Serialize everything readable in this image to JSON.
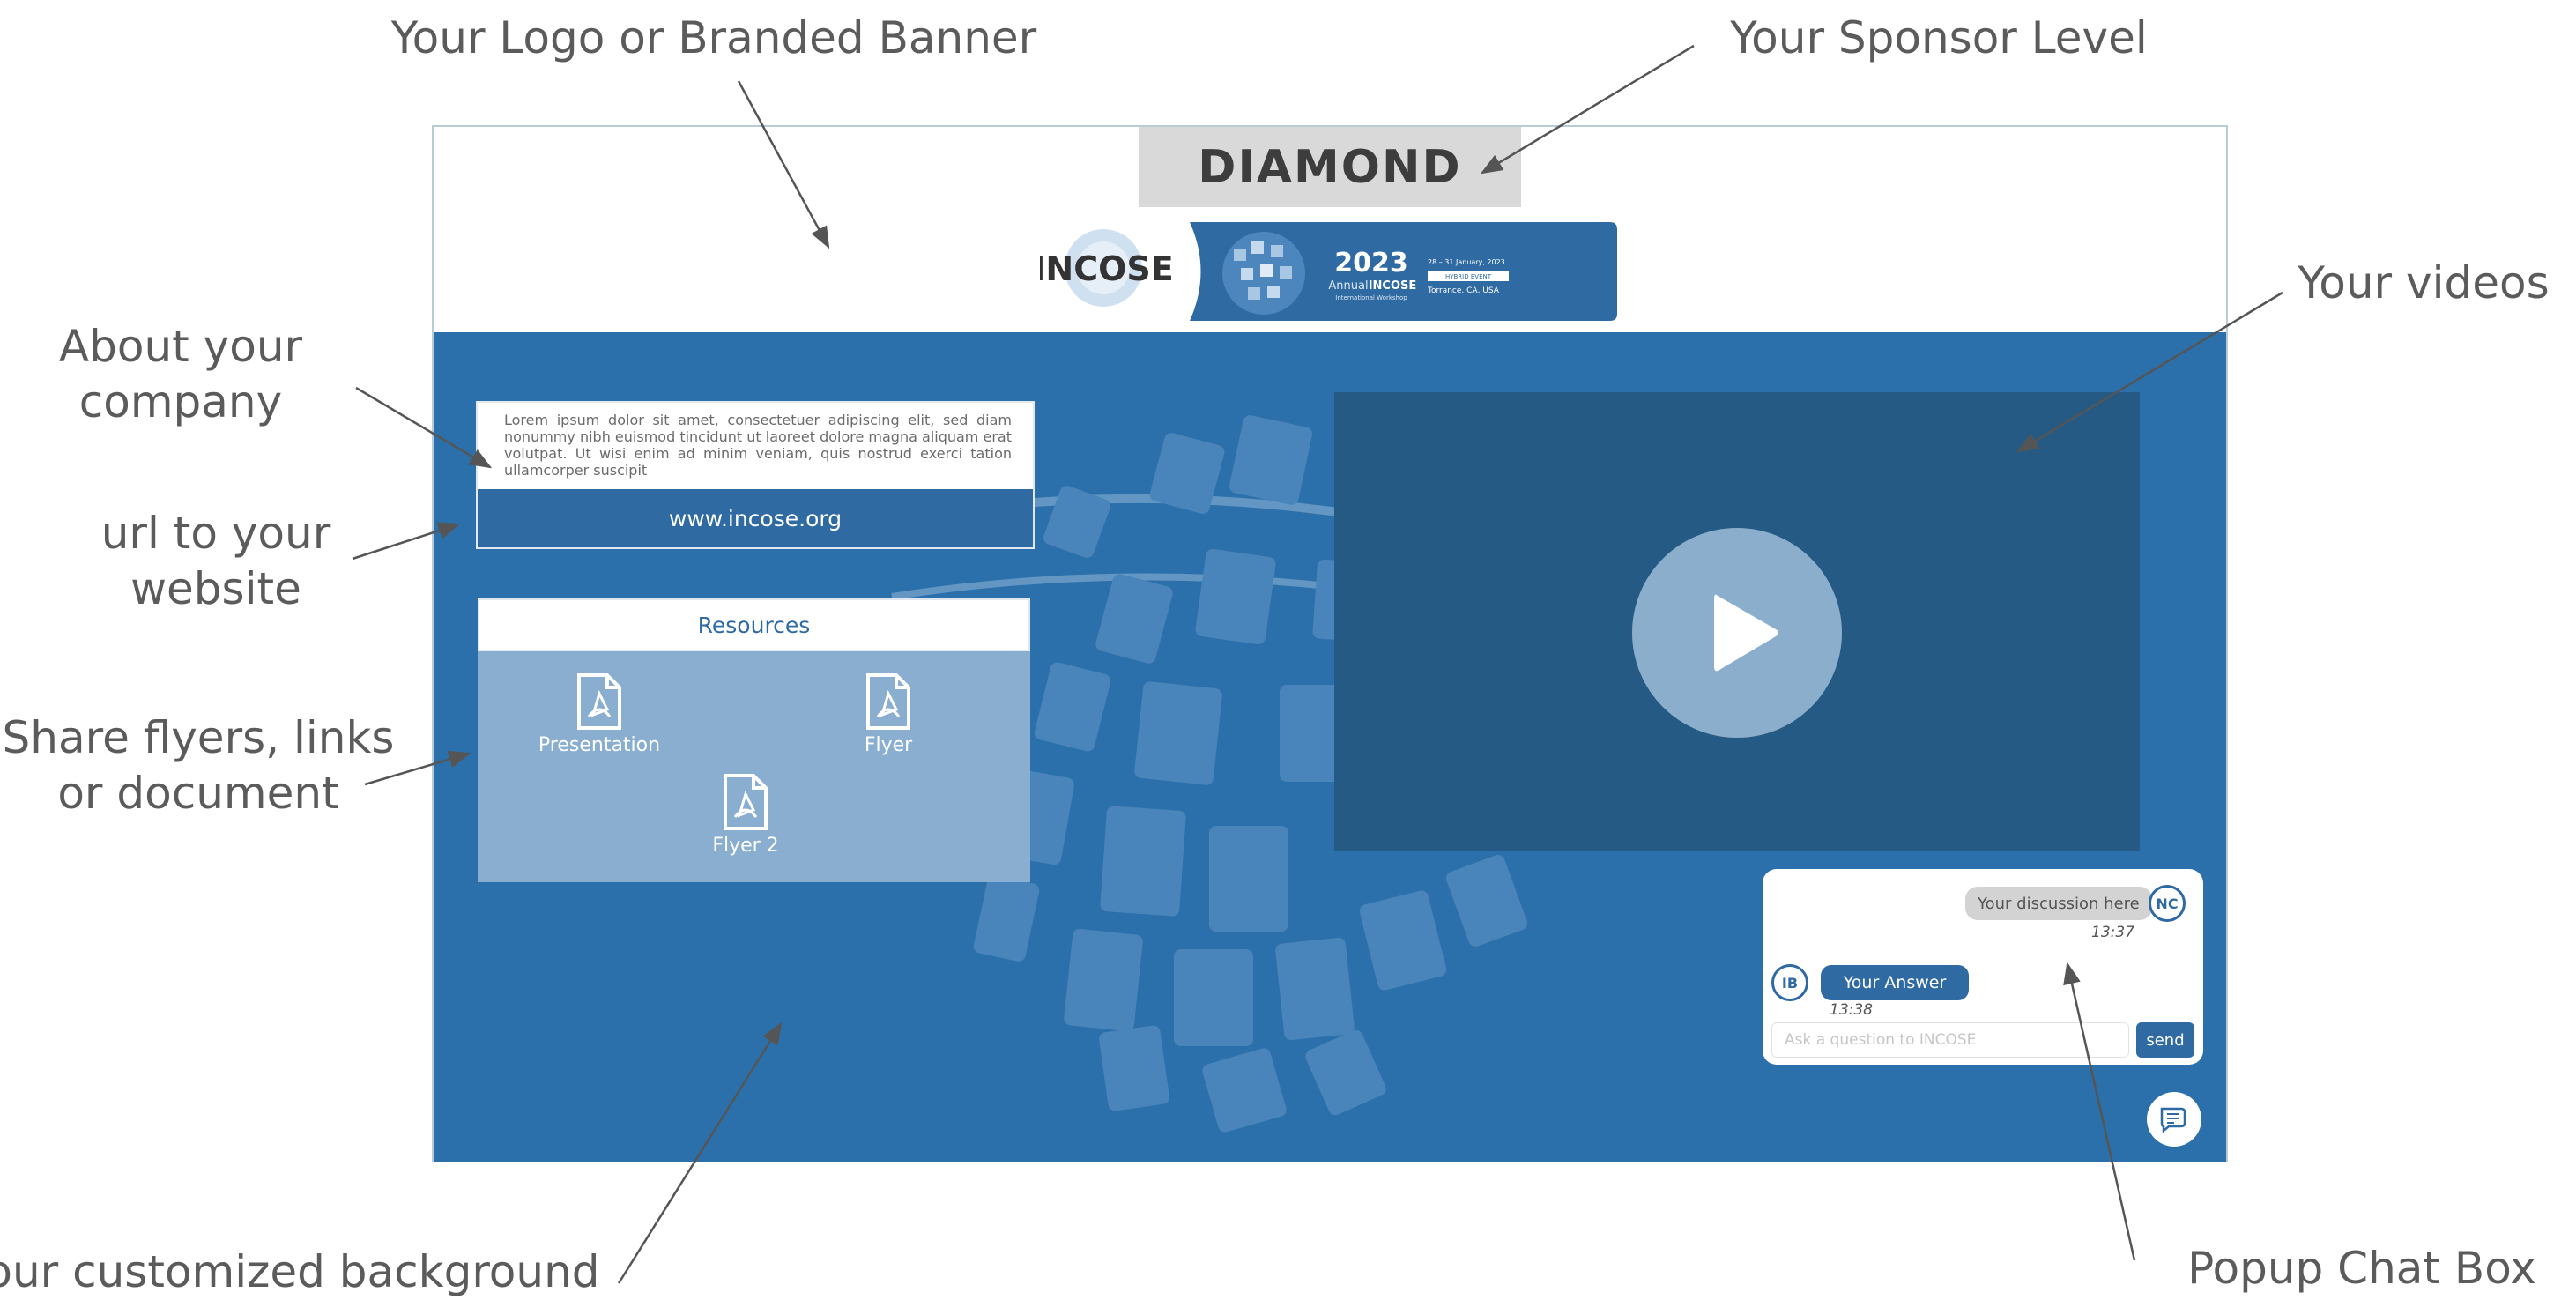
{
  "callouts": {
    "logo": "Your Logo or Branded Banner",
    "sponsor": "Your Sponsor Level",
    "videos": "Your videos",
    "about": "About your\ncompany",
    "url": "url to your\nwebsite",
    "share": "Share flyers, links\nor document",
    "background": "Your customized background",
    "chat": "Popup Chat Box"
  },
  "booth": {
    "sponsor_level": "DIAMOND",
    "banner": {
      "logo_text": "INCOSE",
      "year": "2023",
      "event_line1": "Annual",
      "event_line2": "INCOSE",
      "event_line3": "International Workshop",
      "dates": "28 – 31 January, 2023",
      "hybrid": "HYBRID EVENT",
      "location": "Torrance, CA, USA"
    },
    "about_text": "Lorem ipsum dolor sit amet, consectetuer adipiscing elit, sed diam nonummy nibh euismod tincidunt ut laoreet dolore magna aliquam erat volutpat. Ut wisi enim ad minim veniam, quis nostrud exerci tation ullamcorper suscipit",
    "url": "www.incose.org",
    "resources": {
      "title": "Resources",
      "items": [
        {
          "label": "Presentation",
          "icon": "pdf-file-icon"
        },
        {
          "label": "Flyer",
          "icon": "pdf-file-icon"
        },
        {
          "label": "Flyer 2",
          "icon": "pdf-file-icon"
        }
      ]
    },
    "video": {
      "icon": "play-icon"
    },
    "chat": {
      "message_text": "Your discussion here",
      "message_avatar": "NC",
      "message_time": "13:37",
      "answer_text": "Your Answer",
      "answer_avatar": "IB",
      "answer_time": "13:38",
      "input_placeholder": "Ask a question to INCOSE",
      "send_label": "send",
      "toggle_icon": "chat-bubble-icon"
    }
  },
  "colors": {
    "booth_blue": "#2c70ab",
    "video_dark": "#245a83",
    "resources_light": "#89aecf",
    "sponsor_gray": "#d9d9d9"
  }
}
